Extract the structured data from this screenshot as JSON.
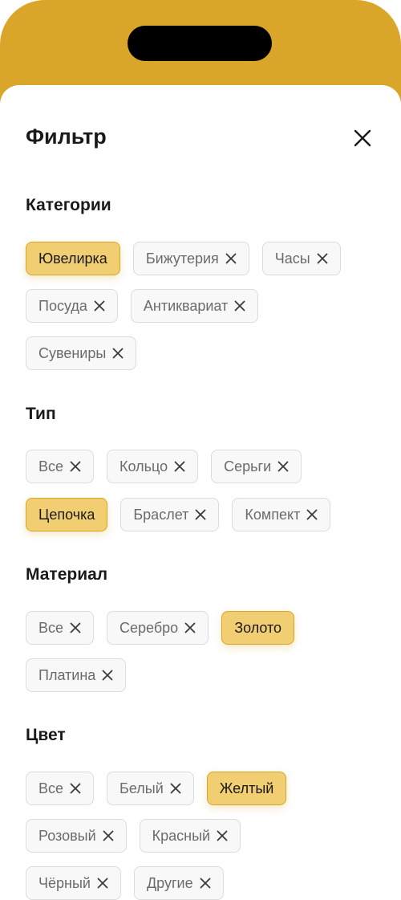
{
  "filter": {
    "title": "Фильтр",
    "sections": [
      {
        "title": "Категории",
        "rows": [
          [
            {
              "label": "Ювелирка",
              "selected": true
            },
            {
              "label": "Бижутерия",
              "selected": false
            },
            {
              "label": "Часы",
              "selected": false
            }
          ],
          [
            {
              "label": "Посуда",
              "selected": false
            },
            {
              "label": "Антиквариат",
              "selected": false
            }
          ],
          [
            {
              "label": "Сувениры",
              "selected": false
            }
          ]
        ]
      },
      {
        "title": "Тип",
        "rows": [
          [
            {
              "label": "Все",
              "selected": false
            },
            {
              "label": "Кольцо",
              "selected": false
            },
            {
              "label": "Серьги",
              "selected": false
            }
          ],
          [
            {
              "label": "Цепочка",
              "selected": true
            },
            {
              "label": "Браслет",
              "selected": false
            },
            {
              "label": "Компект",
              "selected": false
            }
          ]
        ]
      },
      {
        "title": "Материал",
        "rows": [
          [
            {
              "label": "Все",
              "selected": false
            },
            {
              "label": "Серебро",
              "selected": false
            },
            {
              "label": "Золото",
              "selected": true
            }
          ],
          [
            {
              "label": "Платина",
              "selected": false
            }
          ]
        ]
      },
      {
        "title": "Цвет",
        "rows": [
          [
            {
              "label": "Все",
              "selected": false
            },
            {
              "label": "Белый",
              "selected": false
            },
            {
              "label": "Желтый",
              "selected": true
            }
          ],
          [
            {
              "label": "Розовый",
              "selected": false
            },
            {
              "label": "Красный",
              "selected": false
            }
          ],
          [
            {
              "label": "Чёрный",
              "selected": false
            },
            {
              "label": "Другие",
              "selected": false
            }
          ]
        ]
      }
    ]
  },
  "colors": {
    "accent": "#DAA62A",
    "chip_selected_bg": "#F2CE72",
    "chip_bg": "#F8F8F8"
  },
  "icons": {
    "close": "close-icon",
    "chip_remove": "x-icon"
  }
}
